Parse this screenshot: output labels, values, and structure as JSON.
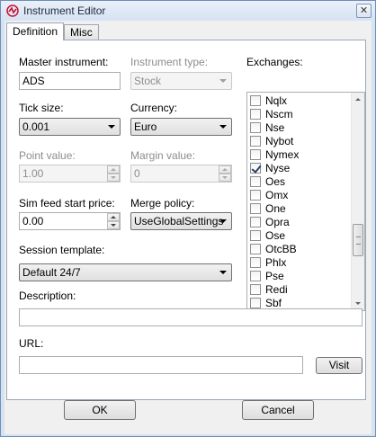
{
  "window": {
    "title": "Instrument Editor",
    "close_glyph": "✕"
  },
  "tabs": [
    {
      "label": "Definition"
    },
    {
      "label": "Misc"
    }
  ],
  "fields": {
    "master_instrument": {
      "label": "Master instrument:",
      "value": "ADS"
    },
    "instrument_type": {
      "label": "Instrument type:",
      "value": "Stock"
    },
    "tick_size": {
      "label": "Tick size:",
      "value": "0.001"
    },
    "currency": {
      "label": "Currency:",
      "value": "Euro"
    },
    "point_value": {
      "label": "Point value:",
      "value": "1.00"
    },
    "margin_value": {
      "label": "Margin value:",
      "value": "0"
    },
    "sim_feed_start_price": {
      "label": "Sim feed start price:",
      "value": "0.00"
    },
    "merge_policy": {
      "label": "Merge policy:",
      "value": "UseGlobalSettings"
    },
    "session_template": {
      "label": "Session template:",
      "value": "Default 24/7"
    },
    "description": {
      "label": "Description:",
      "value": ""
    },
    "url": {
      "label": "URL:",
      "value": ""
    }
  },
  "exchanges": {
    "label": "Exchanges:",
    "items": [
      {
        "name": "Nqlx",
        "checked": false
      },
      {
        "name": "Nscm",
        "checked": false
      },
      {
        "name": "Nse",
        "checked": false
      },
      {
        "name": "Nybot",
        "checked": false
      },
      {
        "name": "Nymex",
        "checked": false
      },
      {
        "name": "Nyse",
        "checked": true
      },
      {
        "name": "Oes",
        "checked": false
      },
      {
        "name": "Omx",
        "checked": false
      },
      {
        "name": "One",
        "checked": false
      },
      {
        "name": "Opra",
        "checked": false
      },
      {
        "name": "Ose",
        "checked": false
      },
      {
        "name": "OtcBB",
        "checked": false
      },
      {
        "name": "Phlx",
        "checked": false
      },
      {
        "name": "Pse",
        "checked": false
      },
      {
        "name": "Redi",
        "checked": false
      },
      {
        "name": "Sbf",
        "checked": false
      }
    ]
  },
  "buttons": {
    "visit": "Visit",
    "ok": "OK",
    "cancel": "Cancel"
  },
  "colors": {
    "window_frame": "#d4e2f2",
    "accent_logo": "#c8102e"
  }
}
